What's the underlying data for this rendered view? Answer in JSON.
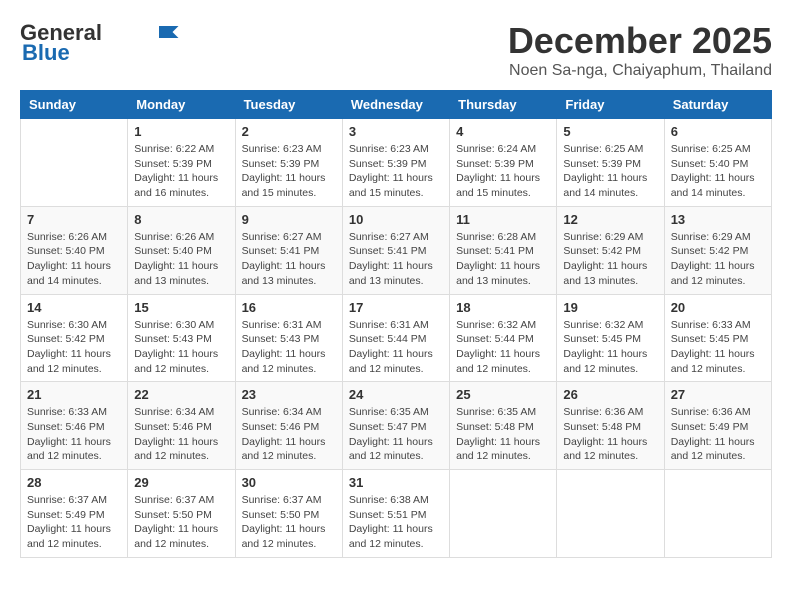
{
  "header": {
    "logo_line1": "General",
    "logo_line2": "Blue",
    "month": "December 2025",
    "location": "Noen Sa-nga, Chaiyaphum, Thailand"
  },
  "weekdays": [
    "Sunday",
    "Monday",
    "Tuesday",
    "Wednesday",
    "Thursday",
    "Friday",
    "Saturday"
  ],
  "weeks": [
    [
      {
        "day": "",
        "info": ""
      },
      {
        "day": "1",
        "info": "Sunrise: 6:22 AM\nSunset: 5:39 PM\nDaylight: 11 hours\nand 16 minutes."
      },
      {
        "day": "2",
        "info": "Sunrise: 6:23 AM\nSunset: 5:39 PM\nDaylight: 11 hours\nand 15 minutes."
      },
      {
        "day": "3",
        "info": "Sunrise: 6:23 AM\nSunset: 5:39 PM\nDaylight: 11 hours\nand 15 minutes."
      },
      {
        "day": "4",
        "info": "Sunrise: 6:24 AM\nSunset: 5:39 PM\nDaylight: 11 hours\nand 15 minutes."
      },
      {
        "day": "5",
        "info": "Sunrise: 6:25 AM\nSunset: 5:39 PM\nDaylight: 11 hours\nand 14 minutes."
      },
      {
        "day": "6",
        "info": "Sunrise: 6:25 AM\nSunset: 5:40 PM\nDaylight: 11 hours\nand 14 minutes."
      }
    ],
    [
      {
        "day": "7",
        "info": "Sunrise: 6:26 AM\nSunset: 5:40 PM\nDaylight: 11 hours\nand 14 minutes."
      },
      {
        "day": "8",
        "info": "Sunrise: 6:26 AM\nSunset: 5:40 PM\nDaylight: 11 hours\nand 13 minutes."
      },
      {
        "day": "9",
        "info": "Sunrise: 6:27 AM\nSunset: 5:41 PM\nDaylight: 11 hours\nand 13 minutes."
      },
      {
        "day": "10",
        "info": "Sunrise: 6:27 AM\nSunset: 5:41 PM\nDaylight: 11 hours\nand 13 minutes."
      },
      {
        "day": "11",
        "info": "Sunrise: 6:28 AM\nSunset: 5:41 PM\nDaylight: 11 hours\nand 13 minutes."
      },
      {
        "day": "12",
        "info": "Sunrise: 6:29 AM\nSunset: 5:42 PM\nDaylight: 11 hours\nand 13 minutes."
      },
      {
        "day": "13",
        "info": "Sunrise: 6:29 AM\nSunset: 5:42 PM\nDaylight: 11 hours\nand 12 minutes."
      }
    ],
    [
      {
        "day": "14",
        "info": "Sunrise: 6:30 AM\nSunset: 5:42 PM\nDaylight: 11 hours\nand 12 minutes."
      },
      {
        "day": "15",
        "info": "Sunrise: 6:30 AM\nSunset: 5:43 PM\nDaylight: 11 hours\nand 12 minutes."
      },
      {
        "day": "16",
        "info": "Sunrise: 6:31 AM\nSunset: 5:43 PM\nDaylight: 11 hours\nand 12 minutes."
      },
      {
        "day": "17",
        "info": "Sunrise: 6:31 AM\nSunset: 5:44 PM\nDaylight: 11 hours\nand 12 minutes."
      },
      {
        "day": "18",
        "info": "Sunrise: 6:32 AM\nSunset: 5:44 PM\nDaylight: 11 hours\nand 12 minutes."
      },
      {
        "day": "19",
        "info": "Sunrise: 6:32 AM\nSunset: 5:45 PM\nDaylight: 11 hours\nand 12 minutes."
      },
      {
        "day": "20",
        "info": "Sunrise: 6:33 AM\nSunset: 5:45 PM\nDaylight: 11 hours\nand 12 minutes."
      }
    ],
    [
      {
        "day": "21",
        "info": "Sunrise: 6:33 AM\nSunset: 5:46 PM\nDaylight: 11 hours\nand 12 minutes."
      },
      {
        "day": "22",
        "info": "Sunrise: 6:34 AM\nSunset: 5:46 PM\nDaylight: 11 hours\nand 12 minutes."
      },
      {
        "day": "23",
        "info": "Sunrise: 6:34 AM\nSunset: 5:46 PM\nDaylight: 11 hours\nand 12 minutes."
      },
      {
        "day": "24",
        "info": "Sunrise: 6:35 AM\nSunset: 5:47 PM\nDaylight: 11 hours\nand 12 minutes."
      },
      {
        "day": "25",
        "info": "Sunrise: 6:35 AM\nSunset: 5:48 PM\nDaylight: 11 hours\nand 12 minutes."
      },
      {
        "day": "26",
        "info": "Sunrise: 6:36 AM\nSunset: 5:48 PM\nDaylight: 11 hours\nand 12 minutes."
      },
      {
        "day": "27",
        "info": "Sunrise: 6:36 AM\nSunset: 5:49 PM\nDaylight: 11 hours\nand 12 minutes."
      }
    ],
    [
      {
        "day": "28",
        "info": "Sunrise: 6:37 AM\nSunset: 5:49 PM\nDaylight: 11 hours\nand 12 minutes."
      },
      {
        "day": "29",
        "info": "Sunrise: 6:37 AM\nSunset: 5:50 PM\nDaylight: 11 hours\nand 12 minutes."
      },
      {
        "day": "30",
        "info": "Sunrise: 6:37 AM\nSunset: 5:50 PM\nDaylight: 11 hours\nand 12 minutes."
      },
      {
        "day": "31",
        "info": "Sunrise: 6:38 AM\nSunset: 5:51 PM\nDaylight: 11 hours\nand 12 minutes."
      },
      {
        "day": "",
        "info": ""
      },
      {
        "day": "",
        "info": ""
      },
      {
        "day": "",
        "info": ""
      }
    ]
  ]
}
